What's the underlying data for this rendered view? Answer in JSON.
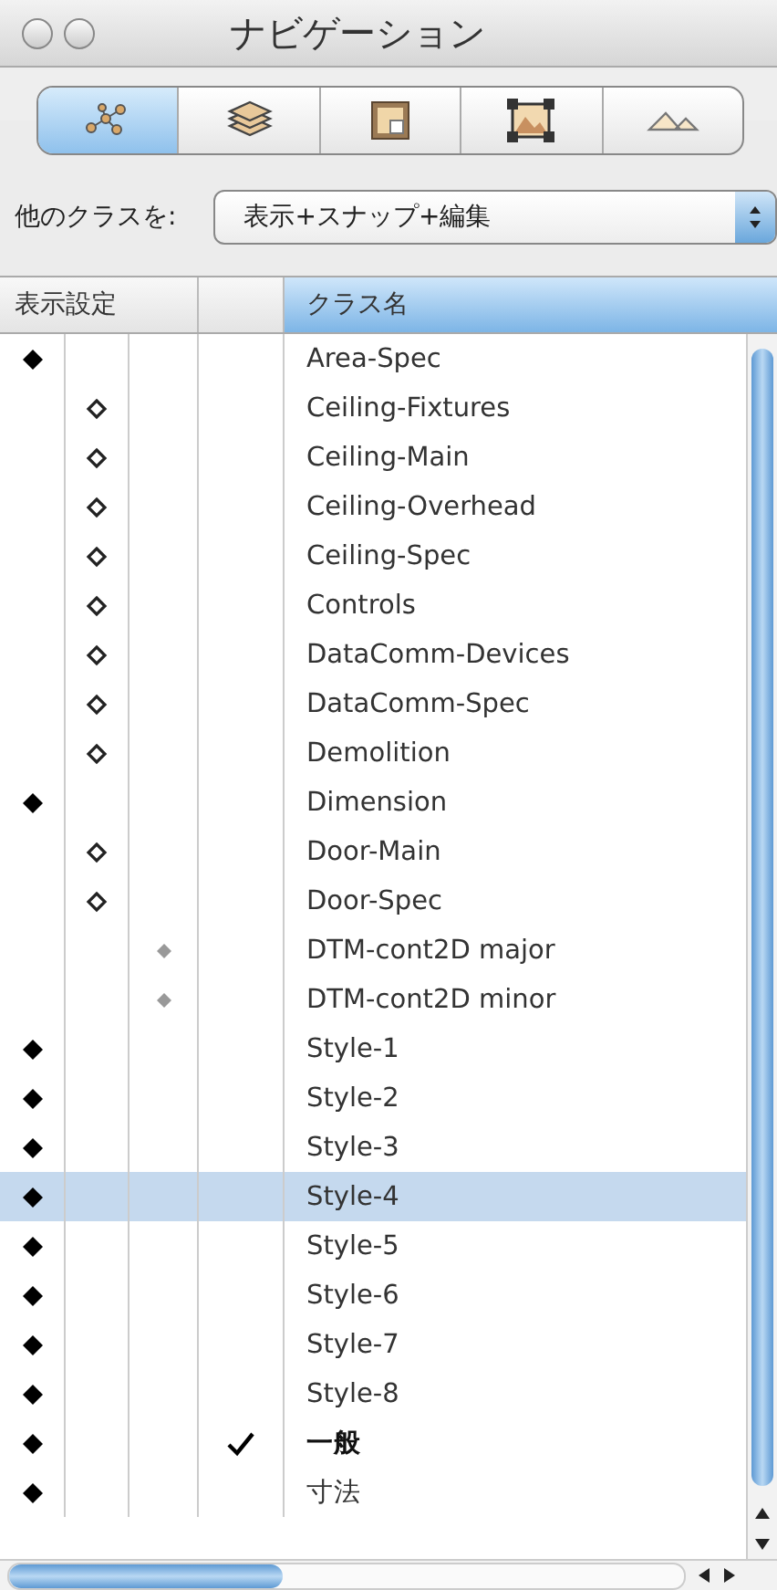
{
  "window": {
    "title": "ナビゲーション"
  },
  "tabs": [
    {
      "kind": "classes",
      "selected": true
    },
    {
      "kind": "layers",
      "selected": false
    },
    {
      "kind": "sheet",
      "selected": false
    },
    {
      "kind": "viewport",
      "selected": false
    },
    {
      "kind": "terrain",
      "selected": false
    }
  ],
  "class_filter": {
    "label": "他のクラスを:",
    "value": "表示+スナップ+編集"
  },
  "table": {
    "columns": [
      {
        "label": "表示設定",
        "selected": false
      },
      {
        "label": "クラス名",
        "selected": true
      }
    ],
    "rows": [
      {
        "name": "Area-Spec",
        "kind": "visible",
        "active": false,
        "selected": false
      },
      {
        "name": "Ceiling-Fixtures",
        "kind": "invisible",
        "active": false,
        "selected": false
      },
      {
        "name": "Ceiling-Main",
        "kind": "invisible",
        "active": false,
        "selected": false
      },
      {
        "name": "Ceiling-Overhead",
        "kind": "invisible",
        "active": false,
        "selected": false
      },
      {
        "name": "Ceiling-Spec",
        "kind": "invisible",
        "active": false,
        "selected": false
      },
      {
        "name": "Controls",
        "kind": "invisible",
        "active": false,
        "selected": false
      },
      {
        "name": "DataComm-Devices",
        "kind": "invisible",
        "active": false,
        "selected": false
      },
      {
        "name": "DataComm-Spec",
        "kind": "invisible",
        "active": false,
        "selected": false
      },
      {
        "name": "Demolition",
        "kind": "invisible",
        "active": false,
        "selected": false
      },
      {
        "name": "Dimension",
        "kind": "visible",
        "active": false,
        "selected": false
      },
      {
        "name": "Door-Main",
        "kind": "invisible",
        "active": false,
        "selected": false
      },
      {
        "name": "Door-Spec",
        "kind": "invisible",
        "active": false,
        "selected": false
      },
      {
        "name": "DTM-cont2D major",
        "kind": "grayed",
        "active": false,
        "selected": false
      },
      {
        "name": "DTM-cont2D minor",
        "kind": "grayed",
        "active": false,
        "selected": false
      },
      {
        "name": "Style-1",
        "kind": "visible",
        "active": false,
        "selected": false
      },
      {
        "name": "Style-2",
        "kind": "visible",
        "active": false,
        "selected": false
      },
      {
        "name": "Style-3",
        "kind": "visible",
        "active": false,
        "selected": false
      },
      {
        "name": "Style-4",
        "kind": "visible",
        "active": false,
        "selected": true
      },
      {
        "name": "Style-5",
        "kind": "visible",
        "active": false,
        "selected": false
      },
      {
        "name": "Style-6",
        "kind": "visible",
        "active": false,
        "selected": false
      },
      {
        "name": "Style-7",
        "kind": "visible",
        "active": false,
        "selected": false
      },
      {
        "name": "Style-8",
        "kind": "visible",
        "active": false,
        "selected": false
      },
      {
        "name": "一般",
        "kind": "visible",
        "active": true,
        "selected": false
      },
      {
        "name": "寸法",
        "kind": "visible",
        "active": false,
        "selected": false
      }
    ]
  }
}
